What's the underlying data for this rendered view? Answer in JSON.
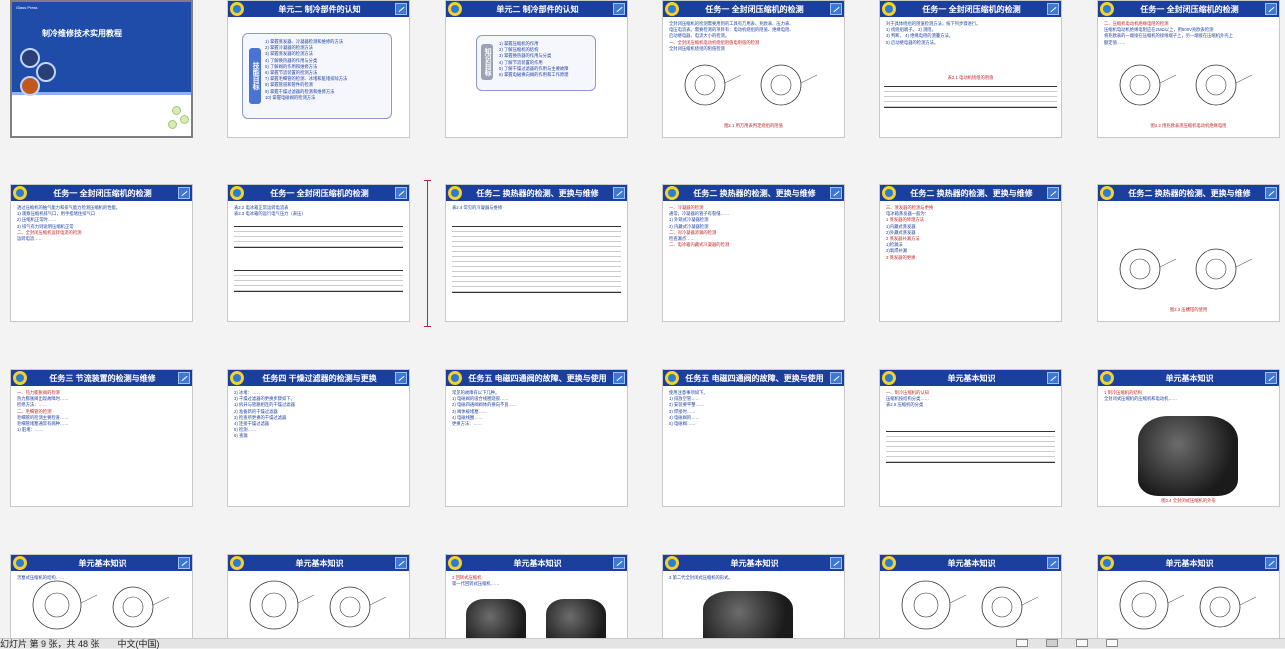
{
  "status": {
    "view": "幻灯片 第 9 张，共 48 张",
    "lang": "中文(中国)"
  },
  "row1": [
    {
      "type": "cover",
      "title": "制冷维修技术实用教程",
      "logo": "Glass Press"
    },
    {
      "type": "unit",
      "title": "单元二 制冷部件的认知",
      "side": "技能目标",
      "lines": [
        "1) 掌握蒸发器、冷凝器检测和维修的方法",
        "2) 掌握冷凝器的检测方法",
        "3) 掌握蒸发器的检测方法",
        "4) 了解换热器的作用与分类",
        "5) 了解阀的作用和维修方法",
        "6) 掌握节流装置的检测方法",
        "7) 掌握毛细管的检测、冰堵和脏堵排除方法",
        "8) 掌握管道和管件的检测",
        "9) 掌握干燥过滤器的检测和维修方法",
        "10) 掌握电磁阀的检测方法"
      ]
    },
    {
      "type": "unit2",
      "title": "单元二 制冷部件的认知",
      "side": "知识目标",
      "lines": [
        "1) 掌握压缩机的作用",
        "2) 了解压缩机的结构",
        "3) 掌握换热器的作用与分类",
        "4) 了解节流装置的作用",
        "5) 了解干燥过滤器的作用与主要故障",
        "6) 掌握电磁换向阀的作用和工作原理"
      ]
    },
    {
      "type": "fig",
      "title": "任务一 全封闭压缩机的检测",
      "lines": [
        "全封闭压缩机的检测需要用到的工具有万用表、兆欧表、压力表、",
        "电压电流表。需要检测的项目有：电动机绕组的阻值、绝缘电阻、",
        "启动继电器、电流大小的检测。",
        "一、全封闭压缩机电动机绕组阻值电阻值的检测",
        "全封闭压缩机绕组的阻值检测"
      ],
      "cap": "图2.1 用万用表判定绕组的阻值"
    },
    {
      "type": "table",
      "title": "任务一 全封闭压缩机的检测",
      "lines": [
        "对于具体绕组的阻值检测方法，按下列步骤进行。",
        "1) 找绕组端子。    2) 测阻。",
        "3) 判断。          4) 绝缘电阻的测量方法。",
        "5) 启动继电器的检测方法。"
      ],
      "cap": "表2.1 电动机绕组的阻值"
    },
    {
      "type": "fig",
      "title": "任务一 全封闭压缩机的检测",
      "lines": [
        "二、压缩机电动机绝缘电阻的检测",
        "压缩机电动机绝缘电阻应在2MΩ以上，用500V兆欧表检测",
        "将兆欧表的一端接在压缩机的接线端子上，另一端接在压缩机外壳上",
        "额定值……"
      ],
      "cap": "图2.2 用兆欧表测压缩机电动机绝缘电阻"
    }
  ],
  "row2": [
    {
      "type": "text",
      "title": "任务一 全封闭压缩机的检测",
      "lines": [
        "透过压缩机的抽气能力和排气能力检测压缩机的性能。",
        "1) 观察压缩机排气口，用手指堵住排气口",
        "2) 压缩机正常时……",
        "3) 排气有力则说明压缩机正常",
        "二、全封闭压缩机运转电流的检测",
        "运转电流……"
      ]
    },
    {
      "type": "table2",
      "title": "任务一 全封闭压缩机的检测",
      "lines": [
        "表2.2 电冰箱正常运转电流表",
        "表2.3 电冰箱的运行电气压力（表压）"
      ]
    },
    {
      "type": "bigtable",
      "title": "任务二 换热器的检测、更换与维修",
      "lines": [
        "表2.4 常见的冷凝器与维修"
      ]
    },
    {
      "type": "text",
      "title": "任务二 换热器的检测、更换与维修",
      "lines": [
        "一、冷凝器的检测",
        "通常，冷凝器的管子有裂缝……",
        "1) 外观式冷凝器检测",
        "2) 内藏式冷凝器检测",
        "二、对冷凝器渗漏的检测",
        "检查漏点……",
        "二、电冰箱内藏式冷凝器的检测"
      ]
    },
    {
      "type": "text",
      "title": "任务二 换热器的检测、更换与维修",
      "lines": [
        "三、蒸发器的检测与更换",
        "电冰箱蒸发器一般为：",
        "1 蒸发器的修理方法",
        "1)内藏式蒸发器",
        "2)外藏式蒸发器",
        "2 蒸发器补漏方法",
        "1)检漏法",
        "2)氧焊补漏",
        "3 蒸发器的更换"
      ]
    },
    {
      "type": "fig",
      "title": "任务二 换热器的检测、更换与维修",
      "lines": [],
      "cap": "图2.3 压槽钳的使用"
    }
  ],
  "row3": [
    {
      "type": "text",
      "title": "任务三 节流装置的检测与维修",
      "lines": [
        "一、热力膨胀阀的检测",
        "热力膨胀阀出现故障时……",
        "检修方法：……",
        "二、毛细管的检测",
        "毛细管的检测主要检查……",
        "毛细管堵塞通常有两种……",
        "1) 脏堵：……"
      ]
    },
    {
      "type": "text",
      "title": "任务四 干燥过滤器的检测与更换",
      "lines": [
        "2) 冰堵：……",
        "3) 干燥过滤器的更换步骤如下。",
        "1) 拆开与管路相连的干燥过滤器",
        "2) 准备新的干燥过滤器",
        "3) 检查所更换的干燥过滤器",
        "4) 连接干燥过滤器",
        "5) 检测……",
        "6) 查漏"
      ]
    },
    {
      "type": "text",
      "title": "任务五 电磁四通阀的故障、更换与使用",
      "lines": [
        "常见的故障有以下几种。",
        "1) 电磁阀的吸合线圈烧毁……",
        "2) 电磁四通阀阀体的换向不良……",
        "3) 阀体被堵塞……",
        "4) 电磁线圈……",
        "更换方法：……"
      ]
    },
    {
      "type": "text",
      "title": "任务五 电磁四通阀的故障、更换与使用",
      "lines": [
        "使用注意事项如下。",
        "1) 排放空管……",
        "2) 安装要平整……",
        "3) 焊接时……",
        "4) 电磁阀的……",
        "5) 电磁阀……"
      ]
    },
    {
      "type": "table3",
      "title": "单元基本知识",
      "lines": [
        "一、制冷压缩机的认知",
        "压缩机按结构分类……",
        "表2.5 压缩机的分类"
      ]
    },
    {
      "type": "comp",
      "title": "单元基本知识",
      "lines": [
        "1 制冷压缩机的结构",
        "全封闭式压缩机的压缩机和电动机……"
      ],
      "cap": "图2.4 全封闭式压缩机的外形"
    }
  ],
  "row4": [
    {
      "type": "figl",
      "title": "单元基本知识",
      "lines": [
        "活塞式压缩机的结构……"
      ]
    },
    {
      "type": "figl",
      "title": "单元基本知识",
      "lines": []
    },
    {
      "type": "comp2",
      "title": "单元基本知识",
      "lines": [
        "2 回转式压缩机",
        "第一代回转式压缩机……"
      ]
    },
    {
      "type": "comp3",
      "title": "单元基本知识",
      "lines": [
        "3 第二代全封闭式压缩机的形式。"
      ]
    },
    {
      "type": "figl",
      "title": "单元基本知识",
      "lines": []
    },
    {
      "type": "figl",
      "title": "单元基本知识",
      "lines": []
    }
  ]
}
